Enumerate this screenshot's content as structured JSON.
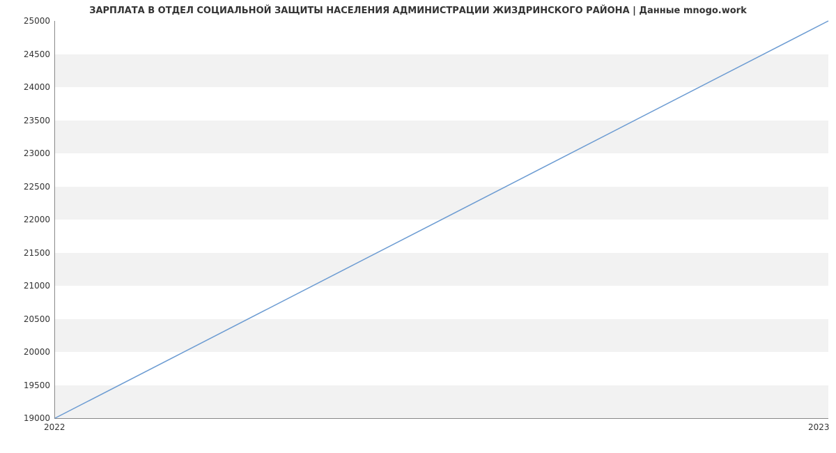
{
  "chart_data": {
    "type": "line",
    "title": "ЗАРПЛАТА В ОТДЕЛ СОЦИАЛЬНОЙ ЗАЩИТЫ НАСЕЛЕНИЯ АДМИНИСТРАЦИИ ЖИЗДРИНСКОГО РАЙОНА | Данные mnogo.work",
    "xlabel": "",
    "ylabel": "",
    "x": [
      "2022",
      "2023"
    ],
    "values": [
      19000,
      25000
    ],
    "y_ticks": [
      19000,
      19500,
      20000,
      20500,
      21000,
      21500,
      22000,
      22500,
      23000,
      23500,
      24000,
      24500,
      25000
    ],
    "x_ticks": [
      "2022",
      "2023"
    ],
    "ylim": [
      19000,
      25000
    ],
    "line_color": "#6b9bd2",
    "band_color": "#f2f2f2"
  }
}
